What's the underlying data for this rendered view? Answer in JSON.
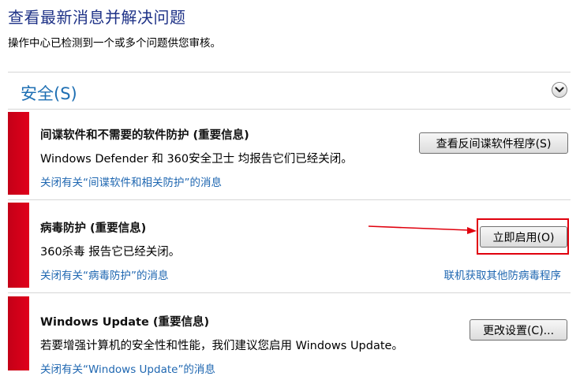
{
  "header": {
    "title": "查看最新消息并解决问题",
    "subtitle": "操作中心已检测到一个或多个问题供您审核。"
  },
  "section": {
    "title": "安全(S)"
  },
  "cards": [
    {
      "title": "间谍软件和不需要的软件防护 (重要信息)",
      "description": "Windows Defender 和 360安全卫士 均报告它们已经关闭。",
      "link": "关闭有关“间谍软件和相关防护”的消息",
      "button": "查看反间谍软件程序(S)"
    },
    {
      "title": "病毒防护 (重要信息)",
      "description": "360杀毒 报告它已经关闭。",
      "link": "关闭有关“病毒防护”的消息",
      "button": "立即启用(O)",
      "right_link": "联机获取其他防病毒程序"
    },
    {
      "title": "Windows Update (重要信息)",
      "description": "若要增强计算机的安全性和性能，我们建议您启用 Windows Update。",
      "link": "关闭有关“Windows Update”的消息",
      "button": "更改设置(C)..."
    }
  ],
  "colors": {
    "accent_bar": "#d0001a",
    "link": "#1f67b1",
    "section_title": "#1e6fb3",
    "highlight": "#e0000d"
  },
  "icons": {
    "collapse": "chevron-down-icon"
  }
}
